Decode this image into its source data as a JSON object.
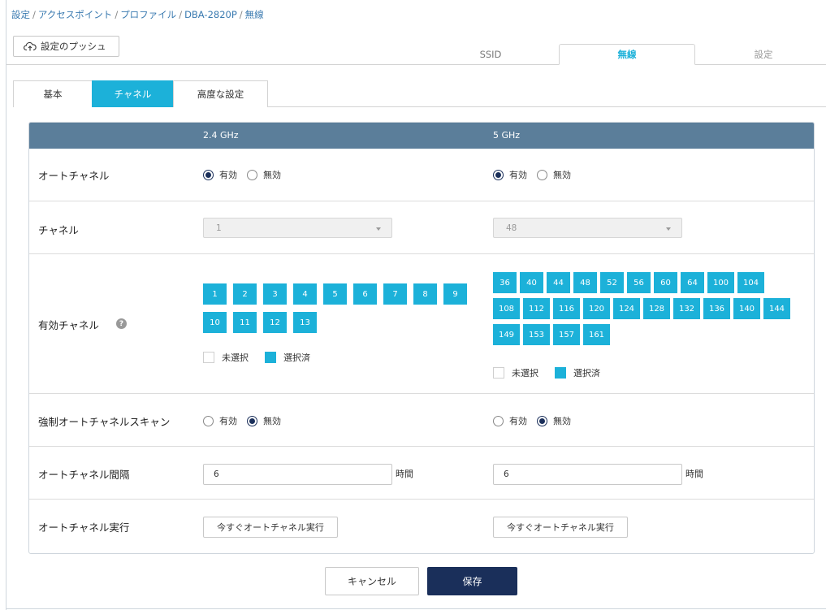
{
  "breadcrumb": [
    "設定",
    "アクセスポイント",
    "プロファイル",
    "DBA-2820P",
    "無線"
  ],
  "push_button": {
    "label": "設定のプッシュ",
    "icon": "cloud-upload-icon"
  },
  "top_tabs": {
    "ssid": "SSID",
    "radio": "無線",
    "settings": "設定",
    "active": "無線"
  },
  "sub_tabs": {
    "basic": "基本",
    "channel": "チャネル",
    "advanced": "高度な設定",
    "active": "チャネル"
  },
  "table": {
    "col_24": "2.4 GHz",
    "col_5": "5 GHz",
    "rows": {
      "auto_channel": "オートチャネル",
      "channel": "チャネル",
      "enabled_channels": "有効チャネル",
      "force_scan": "強制オートチャネルスキャン",
      "interval": "オートチャネル間隔",
      "run": "オートチャネル実行"
    }
  },
  "radio_labels": {
    "on": "有効",
    "off": "無効"
  },
  "auto_channel": {
    "band24": "有効",
    "band5": "有効"
  },
  "force_scan": {
    "band24": "無効",
    "band5": "無効"
  },
  "channel_select": {
    "band24": "1",
    "band5": "48"
  },
  "channels_24": [
    "1",
    "2",
    "3",
    "4",
    "5",
    "6",
    "7",
    "8",
    "9",
    "10",
    "11",
    "12",
    "13"
  ],
  "channels_5": [
    "36",
    "40",
    "44",
    "48",
    "52",
    "56",
    "60",
    "64",
    "100",
    "104",
    "108",
    "112",
    "116",
    "120",
    "124",
    "128",
    "132",
    "136",
    "140",
    "144",
    "149",
    "153",
    "157",
    "161"
  ],
  "legend": {
    "unselected": "未選択",
    "selected": "選択済"
  },
  "help_icon": "?",
  "interval": {
    "band24": "6",
    "band5": "6",
    "unit": "時間"
  },
  "run_button": "今すぐオートチャネル実行",
  "actions": {
    "cancel": "キャンセル",
    "save": "保存"
  },
  "colors": {
    "accent": "#1cb1d9",
    "header": "#5b7e9a",
    "primary": "#1a2f5a",
    "link": "#3a7ab0"
  }
}
